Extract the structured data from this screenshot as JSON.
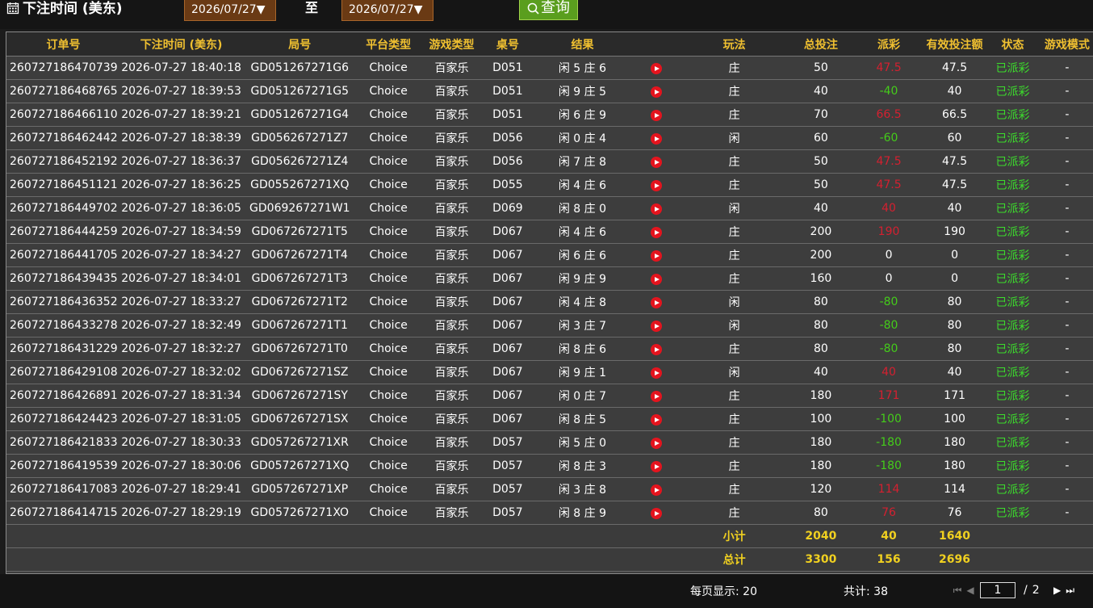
{
  "filter": {
    "title": "下注时间 (美东)",
    "date_from": "2026/07/27▼",
    "to_label": "至",
    "date_to": "2026/07/27▼",
    "query_label": "查询"
  },
  "table": {
    "headers": [
      "订单号",
      "下注时间 (美东)",
      "局号",
      "平台类型",
      "游戏类型",
      "桌号",
      "结果",
      "",
      "玩法",
      "总投注",
      "派彩",
      "有效投注额",
      "状态",
      "游戏模式"
    ],
    "rows": [
      {
        "order": "260727186470739",
        "time": "2026-07-27 18:40:18",
        "round": "GD051267271G6",
        "platform": "Choice",
        "game": "百家乐",
        "table": "D051",
        "result": "闲 5 庄 6",
        "play": "庄",
        "bet": "50",
        "payout": "47.5",
        "payout_color": "red",
        "valid": "47.5",
        "status": "已派彩",
        "mode": "-"
      },
      {
        "order": "260727186468765",
        "time": "2026-07-27 18:39:53",
        "round": "GD051267271G5",
        "platform": "Choice",
        "game": "百家乐",
        "table": "D051",
        "result": "闲 9 庄 5",
        "play": "庄",
        "bet": "40",
        "payout": "-40",
        "payout_color": "green",
        "valid": "40",
        "status": "已派彩",
        "mode": "-"
      },
      {
        "order": "260727186466110",
        "time": "2026-07-27 18:39:21",
        "round": "GD051267271G4",
        "platform": "Choice",
        "game": "百家乐",
        "table": "D051",
        "result": "闲 6 庄 9",
        "play": "庄",
        "bet": "70",
        "payout": "66.5",
        "payout_color": "red",
        "valid": "66.5",
        "status": "已派彩",
        "mode": "-"
      },
      {
        "order": "260727186462442",
        "time": "2026-07-27 18:38:39",
        "round": "GD056267271Z7",
        "platform": "Choice",
        "game": "百家乐",
        "table": "D056",
        "result": "闲 0 庄 4",
        "play": "闲",
        "bet": "60",
        "payout": "-60",
        "payout_color": "green",
        "valid": "60",
        "status": "已派彩",
        "mode": "-"
      },
      {
        "order": "260727186452192",
        "time": "2026-07-27 18:36:37",
        "round": "GD056267271Z4",
        "platform": "Choice",
        "game": "百家乐",
        "table": "D056",
        "result": "闲 7 庄 8",
        "play": "庄",
        "bet": "50",
        "payout": "47.5",
        "payout_color": "red",
        "valid": "47.5",
        "status": "已派彩",
        "mode": "-"
      },
      {
        "order": "260727186451121",
        "time": "2026-07-27 18:36:25",
        "round": "GD055267271XQ",
        "platform": "Choice",
        "game": "百家乐",
        "table": "D055",
        "result": "闲 4 庄 6",
        "play": "庄",
        "bet": "50",
        "payout": "47.5",
        "payout_color": "red",
        "valid": "47.5",
        "status": "已派彩",
        "mode": "-"
      },
      {
        "order": "260727186449702",
        "time": "2026-07-27 18:36:05",
        "round": "GD069267271W1",
        "platform": "Choice",
        "game": "百家乐",
        "table": "D069",
        "result": "闲 8 庄 0",
        "play": "闲",
        "bet": "40",
        "payout": "40",
        "payout_color": "red",
        "valid": "40",
        "status": "已派彩",
        "mode": "-"
      },
      {
        "order": "260727186444259",
        "time": "2026-07-27 18:34:59",
        "round": "GD067267271T5",
        "platform": "Choice",
        "game": "百家乐",
        "table": "D067",
        "result": "闲 4 庄 6",
        "play": "庄",
        "bet": "200",
        "payout": "190",
        "payout_color": "red",
        "valid": "190",
        "status": "已派彩",
        "mode": "-"
      },
      {
        "order": "260727186441705",
        "time": "2026-07-27 18:34:27",
        "round": "GD067267271T4",
        "platform": "Choice",
        "game": "百家乐",
        "table": "D067",
        "result": "闲 6 庄 6",
        "play": "庄",
        "bet": "200",
        "payout": "0",
        "payout_color": "white",
        "valid": "0",
        "status": "已派彩",
        "mode": "-"
      },
      {
        "order": "260727186439435",
        "time": "2026-07-27 18:34:01",
        "round": "GD067267271T3",
        "platform": "Choice",
        "game": "百家乐",
        "table": "D067",
        "result": "闲 9 庄 9",
        "play": "庄",
        "bet": "160",
        "payout": "0",
        "payout_color": "white",
        "valid": "0",
        "status": "已派彩",
        "mode": "-"
      },
      {
        "order": "260727186436352",
        "time": "2026-07-27 18:33:27",
        "round": "GD067267271T2",
        "platform": "Choice",
        "game": "百家乐",
        "table": "D067",
        "result": "闲 4 庄 8",
        "play": "闲",
        "bet": "80",
        "payout": "-80",
        "payout_color": "green",
        "valid": "80",
        "status": "已派彩",
        "mode": "-"
      },
      {
        "order": "260727186433278",
        "time": "2026-07-27 18:32:49",
        "round": "GD067267271T1",
        "platform": "Choice",
        "game": "百家乐",
        "table": "D067",
        "result": "闲 3 庄 7",
        "play": "闲",
        "bet": "80",
        "payout": "-80",
        "payout_color": "green",
        "valid": "80",
        "status": "已派彩",
        "mode": "-"
      },
      {
        "order": "260727186431229",
        "time": "2026-07-27 18:32:27",
        "round": "GD067267271T0",
        "platform": "Choice",
        "game": "百家乐",
        "table": "D067",
        "result": "闲 8 庄 6",
        "play": "庄",
        "bet": "80",
        "payout": "-80",
        "payout_color": "green",
        "valid": "80",
        "status": "已派彩",
        "mode": "-"
      },
      {
        "order": "260727186429108",
        "time": "2026-07-27 18:32:02",
        "round": "GD067267271SZ",
        "platform": "Choice",
        "game": "百家乐",
        "table": "D067",
        "result": "闲 9 庄 1",
        "play": "闲",
        "bet": "40",
        "payout": "40",
        "payout_color": "red",
        "valid": "40",
        "status": "已派彩",
        "mode": "-"
      },
      {
        "order": "260727186426891",
        "time": "2026-07-27 18:31:34",
        "round": "GD067267271SY",
        "platform": "Choice",
        "game": "百家乐",
        "table": "D067",
        "result": "闲 0 庄 7",
        "play": "庄",
        "bet": "180",
        "payout": "171",
        "payout_color": "red",
        "valid": "171",
        "status": "已派彩",
        "mode": "-"
      },
      {
        "order": "260727186424423",
        "time": "2026-07-27 18:31:05",
        "round": "GD067267271SX",
        "platform": "Choice",
        "game": "百家乐",
        "table": "D067",
        "result": "闲 8 庄 5",
        "play": "庄",
        "bet": "100",
        "payout": "-100",
        "payout_color": "green",
        "valid": "100",
        "status": "已派彩",
        "mode": "-"
      },
      {
        "order": "260727186421833",
        "time": "2026-07-27 18:30:33",
        "round": "GD057267271XR",
        "platform": "Choice",
        "game": "百家乐",
        "table": "D057",
        "result": "闲 5 庄 0",
        "play": "庄",
        "bet": "180",
        "payout": "-180",
        "payout_color": "green",
        "valid": "180",
        "status": "已派彩",
        "mode": "-"
      },
      {
        "order": "260727186419539",
        "time": "2026-07-27 18:30:06",
        "round": "GD057267271XQ",
        "platform": "Choice",
        "game": "百家乐",
        "table": "D057",
        "result": "闲 8 庄 3",
        "play": "庄",
        "bet": "180",
        "payout": "-180",
        "payout_color": "green",
        "valid": "180",
        "status": "已派彩",
        "mode": "-"
      },
      {
        "order": "260727186417083",
        "time": "2026-07-27 18:29:41",
        "round": "GD057267271XP",
        "platform": "Choice",
        "game": "百家乐",
        "table": "D057",
        "result": "闲 3 庄 8",
        "play": "庄",
        "bet": "120",
        "payout": "114",
        "payout_color": "red",
        "valid": "114",
        "status": "已派彩",
        "mode": "-"
      },
      {
        "order": "260727186414715",
        "time": "2026-07-27 18:29:19",
        "round": "GD057267271XO",
        "platform": "Choice",
        "game": "百家乐",
        "table": "D057",
        "result": "闲 8 庄 9",
        "play": "庄",
        "bet": "80",
        "payout": "76",
        "payout_color": "red",
        "valid": "76",
        "status": "已派彩",
        "mode": "-"
      }
    ],
    "subtotal": {
      "label": "小计",
      "bet": "2040",
      "payout": "40",
      "valid": "1640"
    },
    "total": {
      "label": "总计",
      "bet": "3300",
      "payout": "156",
      "valid": "2696"
    }
  },
  "footer": {
    "per_page": "每页显示: 20",
    "count": "共计: 38",
    "page_current": "1",
    "page_slash": "/",
    "page_total": "2",
    "nav_first": "⏮",
    "nav_prev": "◀",
    "nav_next": "▶",
    "nav_last": "⏭"
  },
  "colors": {
    "header_text": "#f0c030",
    "payout_red": "#d42030",
    "payout_green": "#44cc1a",
    "status_green": "#3cdc2c",
    "sum_text": "#f0d020"
  }
}
